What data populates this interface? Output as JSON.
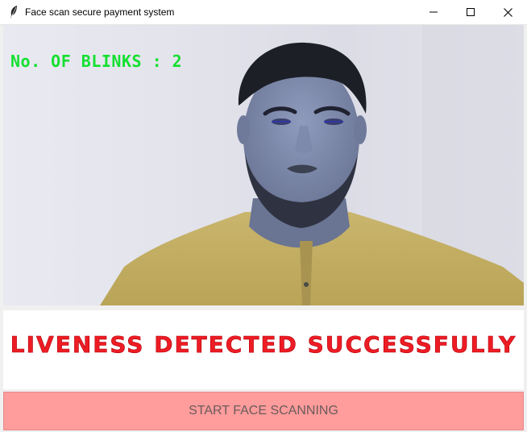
{
  "window": {
    "title": "Face scan secure payment system",
    "icon": "feather-icon",
    "controls": [
      "minimize-icon",
      "maximize-icon",
      "close-icon"
    ]
  },
  "camera": {
    "overlay_text": "No. OF BLINKS : 2",
    "overlay_color": "#14e030"
  },
  "status": {
    "message": "LIVENESS DETECTED SUCCESSFULLY",
    "color": "#ee1c24"
  },
  "actions": {
    "start_button_label": "START FACE SCANNING",
    "start_button_color": "#ff9c9c"
  }
}
